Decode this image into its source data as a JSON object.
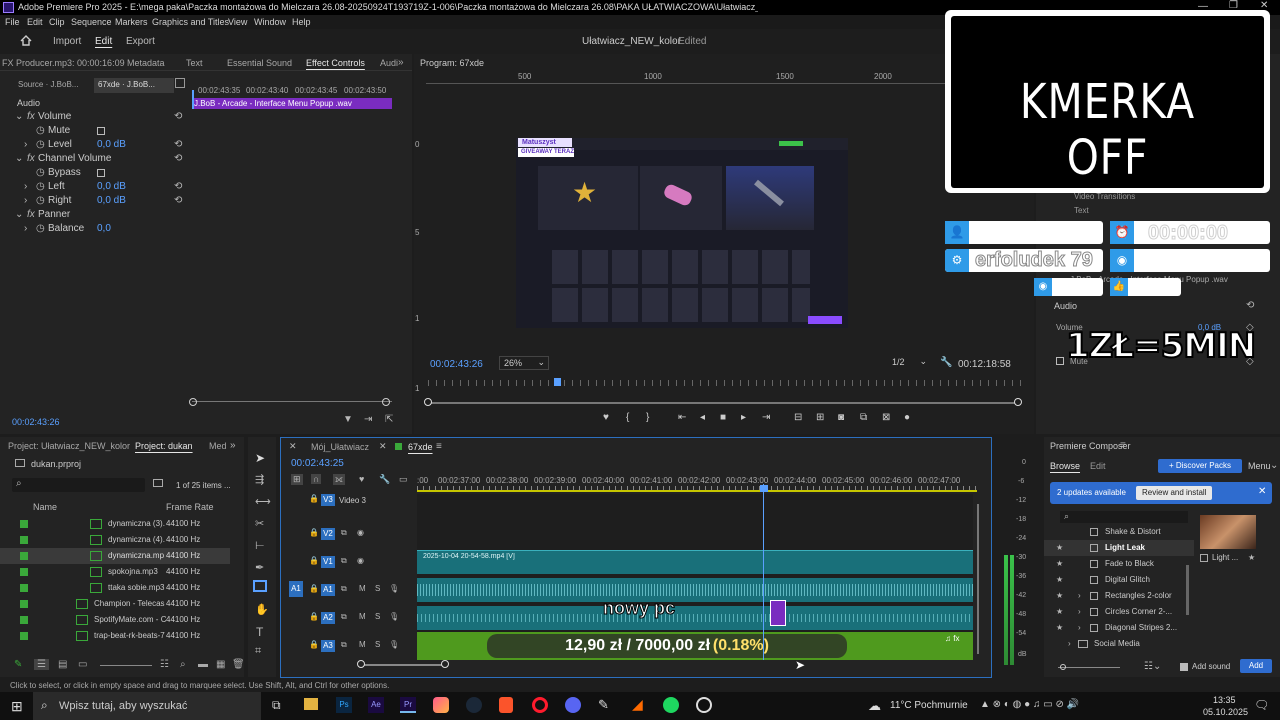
{
  "titlebar": {
    "text": "Adobe Premiere Pro 2025 - E:\\mega paka\\Paczka montażowa do Mielczara 26.08-20250924T193719Z-1-006\\Paczka montażowa do Mielczara 26.08\\PAKA UŁATWIACZOWA\\Ułatwiacz_NEW_kolor.prproj *"
  },
  "menu": [
    "File",
    "Edit",
    "Clip",
    "Sequence",
    "Markers",
    "Graphics and Titles",
    "View",
    "Window",
    "Help"
  ],
  "workspace": {
    "tabs": [
      "Import",
      "Edit",
      "Export"
    ],
    "active": "Edit",
    "project_title": "Ułatwiacz_NEW_kolor",
    "status": "- Edited"
  },
  "effect_controls": {
    "tabs": [
      "FX Producer.mp3: 00:00:16:09",
      "Metadata",
      "Text",
      "Essential Sound",
      "Effect Controls",
      "Audi"
    ],
    "active_tab": "Effect Controls",
    "source_tabs": [
      "Source · J.BoB...",
      "67xde · J.BoB..."
    ],
    "ruler": [
      "00:02:43:35",
      "00:02:43:40",
      "00:02:43:45",
      "00:02:43:50"
    ],
    "clip": "J.BoB - Arcade - Interface Menu Popup .wav",
    "section": "Audio",
    "rows": [
      {
        "label": "Volume",
        "value": "",
        "indent": 1
      },
      {
        "label": "Mute",
        "value": "",
        "indent": 2
      },
      {
        "label": "Level",
        "value": "0,0 dB",
        "indent": 2
      },
      {
        "label": "Channel Volume",
        "value": "",
        "indent": 1
      },
      {
        "label": "Bypass",
        "value": "",
        "indent": 2
      },
      {
        "label": "Left",
        "value": "0,0 dB",
        "indent": 2
      },
      {
        "label": "Right",
        "value": "0,0 dB",
        "indent": 2
      },
      {
        "label": "Panner",
        "value": "",
        "indent": 1
      },
      {
        "label": "Balance",
        "value": "0,0",
        "indent": 2
      }
    ],
    "timecode": "00:02:43:26"
  },
  "program": {
    "title": "Program: 67xde",
    "ruler": [
      "500",
      "1000",
      "1500",
      "2000"
    ],
    "vruler": [
      "0",
      "5",
      "1",
      "1"
    ],
    "timecode": "00:02:43:26",
    "zoom": "26%",
    "quality": "1/2",
    "duration": "00:12:18:58",
    "preview": {
      "badge1": "Matuszyst",
      "badge2": "GIVEAWAY TERAZ!"
    }
  },
  "overlay": {
    "cam_text": "KMERKA OFF",
    "timer": "00:00:00",
    "nick": "erfoludek 79",
    "rate": "1ZŁ=5MIN",
    "subtitle": "nowy pc",
    "goal": "12,90 zł / 7000,00 zł",
    "goal_pct": "(0.18%)"
  },
  "right_panel": {
    "items": [
      "Video Transitions",
      "Text"
    ],
    "clip": "J.BoB - Arcade - Interface Menu Popup .wav",
    "section": "Audio",
    "volume_label": "Volume",
    "volume_value": "0,0 dB",
    "mute_label": "Mute"
  },
  "project": {
    "tabs": [
      "Project: Ułatwiacz_NEW_kolor",
      "Project: dukan",
      "Med"
    ],
    "active": "Project: dukan",
    "file": "dukan.prproj",
    "count": "1 of 25 items ...",
    "columns": [
      "Name",
      "Frame Rate"
    ],
    "rows": [
      {
        "name": "dynamiczna (3).",
        "rate": "44100 Hz"
      },
      {
        "name": "dynamiczna (4).",
        "rate": "44100 Hz"
      },
      {
        "name": "dynamiczna.mp",
        "rate": "44100 Hz"
      },
      {
        "name": "spokojna.mp3",
        "rate": "44100 Hz"
      },
      {
        "name": "ttaka sobie.mp3",
        "rate": "44100 Hz"
      },
      {
        "name": "Champion - Telecas",
        "rate": "44100 Hz"
      },
      {
        "name": "SpotifyMate.com - C",
        "rate": "44100 Hz"
      },
      {
        "name": "trap-beat-rk-beats-7",
        "rate": "44100 Hz"
      }
    ]
  },
  "timeline": {
    "tabs": [
      "Mój_Ułatwiacz",
      "67xde"
    ],
    "active": "67xde",
    "timecode": "00:02:43:25",
    "ruler": [
      ":00",
      "00:02:37:00",
      "00:02:38:00",
      "00:02:39:00",
      "00:02:40:00",
      "00:02:41:00",
      "00:02:42:00",
      "00:02:43:00",
      "00:02:44:00",
      "00:02:45:00",
      "00:02:46:00",
      "00:02:47:00"
    ],
    "tracks": [
      "V3",
      "V2",
      "V1",
      "A1",
      "A2",
      "A3"
    ],
    "track_name_v3": "Video 3",
    "clip_v1": "2025-10-04 20-54-58.mp4 [V]",
    "meter": [
      "0",
      "-6",
      "-12",
      "-18",
      "-24",
      "-30",
      "-36",
      "-42",
      "-48",
      "-54",
      "dB"
    ]
  },
  "composer": {
    "title": "Premiere Composer",
    "tabs": [
      "Browse",
      "Edit"
    ],
    "discover": "+ Discover Packs",
    "menu": "Menu",
    "notice": "2 updates available",
    "notice_btn": "Review and install",
    "items": [
      "Shake & Distort",
      "Light Leak",
      "Fade to Black",
      "Digital Glitch",
      "Rectangles 2-color",
      "Circles Corner 2-...",
      "Diagonal Stripes 2...",
      "Social Media"
    ],
    "thumb_label": "Light ...",
    "add_sound": "Add sound",
    "add": "Add"
  },
  "status": "Click to select, or click in empty space and drag to marquee select. Use Shift, Alt, and Ctrl for other options.",
  "taskbar": {
    "search": "Wpisz tutaj, aby wyszukać",
    "weather": "11°C  Pochmurnie",
    "time": "13:35",
    "date": "05.10.2025"
  }
}
